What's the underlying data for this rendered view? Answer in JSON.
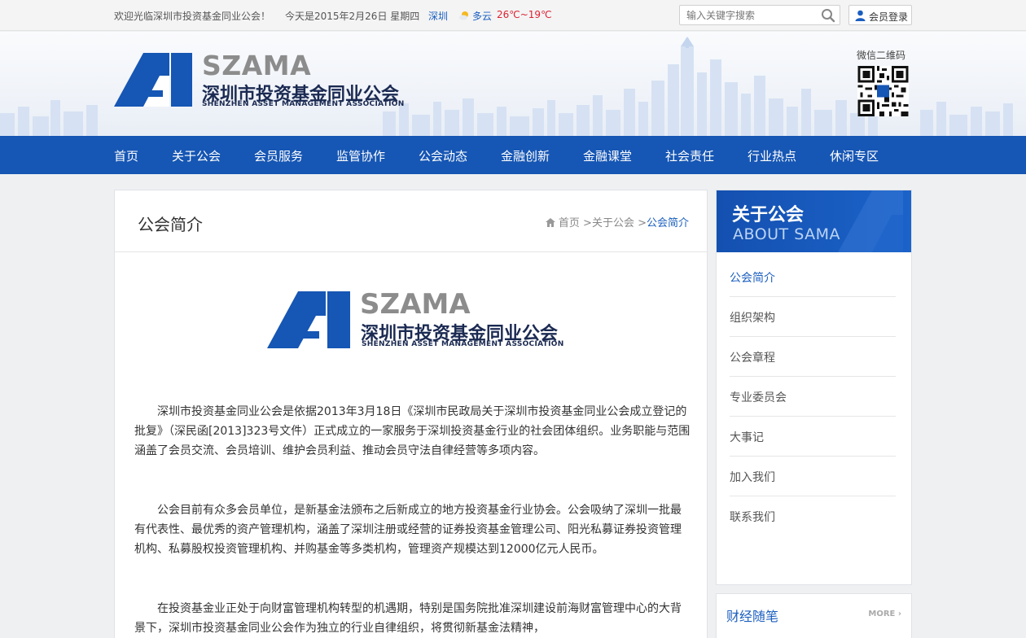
{
  "topbar": {
    "welcome": "欢迎光临深圳市投资基金同业公会！",
    "today": "今天是2015年2月26日 星期四",
    "city": "深圳",
    "weather": "多云",
    "temperature": "26℃~19℃",
    "search_placeholder": "输入关键字搜索",
    "login_label": "会员登录"
  },
  "header": {
    "logo_abbr": "SZAMA",
    "logo_cn": "深圳市投资基金同业公会",
    "logo_en": "SHENZHEN ASSET MANAGEMENT ASSOCIATION",
    "qr_label": "微信二维码"
  },
  "nav": {
    "items": [
      "首页",
      "关于公会",
      "会员服务",
      "监管协作",
      "公会动态",
      "金融创新",
      "金融课堂",
      "社会责任",
      "行业热点",
      "休闲专区"
    ]
  },
  "main": {
    "title": "公会简介",
    "breadcrumb": {
      "home": "首页",
      "sep1": " >",
      "level1": "关于公会",
      "sep2": " >",
      "current": "公会简介"
    },
    "paragraphs": [
      "深圳市投资基金同业公会是依据2013年3月18日《深圳市民政局关于深圳市投资基金同业公会成立登记的批复》（深民函[2013]323号文件）正式成立的一家服务于深圳投资基金行业的社会团体组织。业务职能与范围涵盖了会员交流、会员培训、维护会员利益、推动会员守法自律经营等多项内容。",
      "公会目前有众多会员单位，是新基金法颁布之后新成立的地方投资基金行业协会。公会吸纳了深圳一批最有代表性、最优秀的资产管理机构，涵盖了深圳注册或经营的证券投资基金管理公司、阳光私募证券投资管理机构、私募股权投资管理机构、并购基金等多类机构，管理资产规模达到12000亿元人民币。",
      "在投资基金业正处于向财富管理机构转型的机遇期，特别是国务院批准深圳建设前海财富管理中心的大背景下，深圳市投资基金同业公会作为独立的行业自律组织，将贯彻新基金法精神，"
    ]
  },
  "sidebar": {
    "title_cn": "关于公会",
    "title_en": "ABOUT SAMA",
    "items": [
      "公会简介",
      "组织架构",
      "公会章程",
      "专业委员会",
      "大事记",
      "加入我们",
      "联系我们"
    ],
    "active_index": 0
  },
  "sidebar2": {
    "title": "财经随笔",
    "more": "MORE ›"
  },
  "colors": {
    "brand_blue": "#1656b4",
    "link_blue": "#1a5ebf",
    "logo_gray": "#8c8c8c",
    "temp_red": "#d22233"
  }
}
